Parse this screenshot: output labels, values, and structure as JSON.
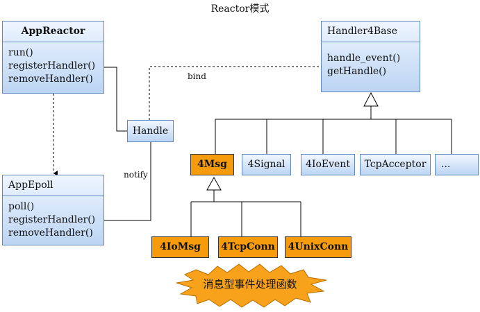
{
  "title": "Reactor模式",
  "app_reactor": {
    "name": "AppReactor",
    "ops": [
      "run()",
      "registerHandler()",
      "removeHandler()"
    ]
  },
  "app_epoll": {
    "name": "AppEpoll",
    "ops": [
      "poll()",
      "registerHandler()",
      "removeHandler()"
    ]
  },
  "handler_base": {
    "name": "Handler4Base",
    "ops": [
      "handle_event()",
      "getHandle()"
    ]
  },
  "handle": "Handle",
  "labels": {
    "bind": "bind",
    "notify": "notify"
  },
  "subclasses": [
    "4Msg",
    "4Signal",
    "4IoEvent",
    "TcpAcceptor",
    "..."
  ],
  "msg_subclasses": [
    "4IoMsg",
    "4TcpConn",
    "4UnixConn"
  ],
  "callout": "消息型事件处理函数",
  "colors": {
    "box_border": "#5f86bd",
    "box_fill": "#bcd5f3",
    "highlight": "#f59b0c",
    "callout": "#f7a21a"
  }
}
